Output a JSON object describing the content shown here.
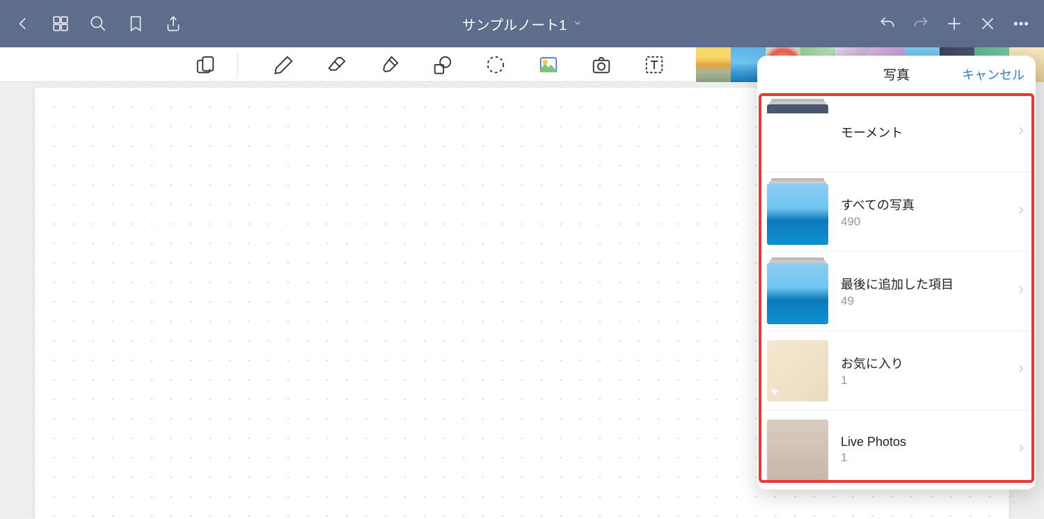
{
  "header": {
    "title": "サンプルノート1"
  },
  "photo_picker": {
    "title": "写真",
    "cancel": "キャンセル",
    "albums": [
      {
        "name": "モーメント",
        "count": ""
      },
      {
        "name": "すべての写真",
        "count": "490"
      },
      {
        "name": "最後に追加した項目",
        "count": "49"
      },
      {
        "name": "お気に入り",
        "count": "1"
      },
      {
        "name": "Live Photos",
        "count": "1"
      }
    ]
  }
}
